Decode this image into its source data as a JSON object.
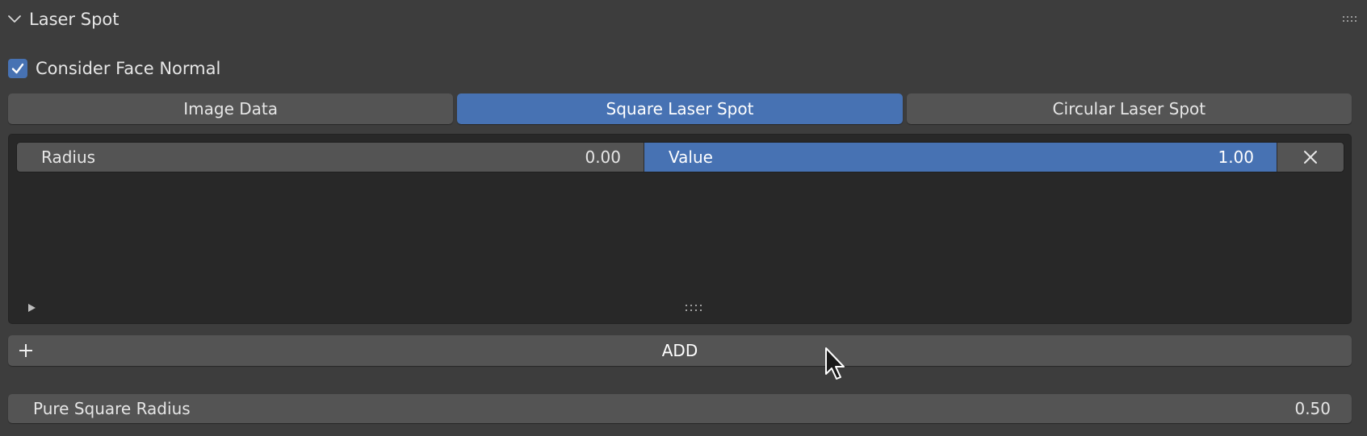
{
  "panel": {
    "title": "Laser Spot",
    "collapse_icon": "chevron-down-icon",
    "grip_icon": "drag-grip-icon"
  },
  "consider_face_normal": {
    "label": "Consider Face Normal",
    "checked": true
  },
  "tabs": [
    {
      "label": "Image Data",
      "active": false
    },
    {
      "label": "Square Laser Spot",
      "active": true
    },
    {
      "label": "Circular Laser Spot",
      "active": false
    }
  ],
  "spot_list": {
    "rows": [
      {
        "radius_label": "Radius",
        "radius_value": "0.00",
        "value_label": "Value",
        "value_value": "1.00",
        "remove_icon": "close-icon"
      }
    ]
  },
  "add_button": {
    "label": "ADD",
    "icon": "plus-icon"
  },
  "pure_square_radius": {
    "label": "Pure Square Radius",
    "value": "0.50"
  },
  "colors": {
    "accent": "#4772b3",
    "widget": "#545454",
    "background": "#3d3d3d",
    "list_background": "#282828"
  }
}
